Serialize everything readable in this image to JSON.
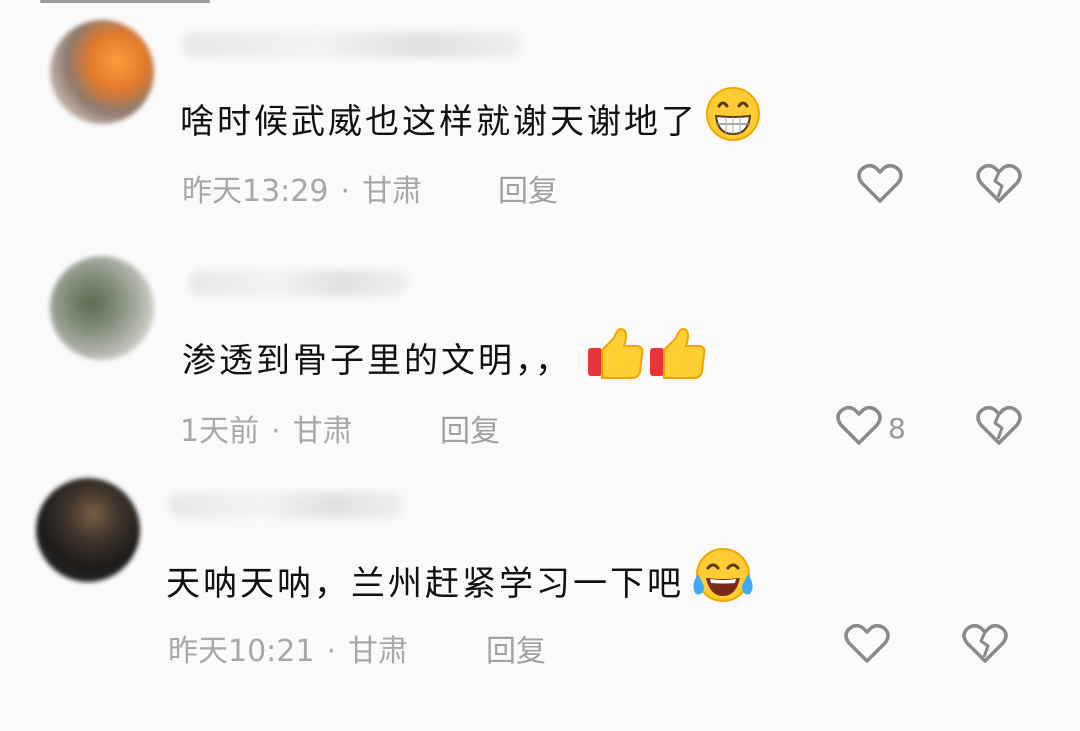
{
  "comments": [
    {
      "text": "啥时候武威也这样就谢天谢地了",
      "emoji": "grinning-face",
      "time": "昨天13:29",
      "separator": "·",
      "location": "甘肃",
      "reply_label": "回复",
      "like_count": ""
    },
    {
      "text": "渗透到骨子里的文明，，",
      "emoji": "thumbs-up-x2",
      "time": "1天前",
      "separator": "·",
      "location": "甘肃",
      "reply_label": "回复",
      "like_count": "8"
    },
    {
      "text": "天呐天呐，兰州赶紧学习一下吧",
      "emoji": "tears-of-joy",
      "time": "昨天10:21",
      "separator": "·",
      "location": "甘肃",
      "reply_label": "回复",
      "like_count": ""
    }
  ],
  "icons": {
    "like": "heart-outline-icon",
    "dislike": "broken-heart-outline-icon"
  },
  "colors": {
    "text": "#111111",
    "meta": "#a8a8a8",
    "icon": "#8a8a8a"
  }
}
